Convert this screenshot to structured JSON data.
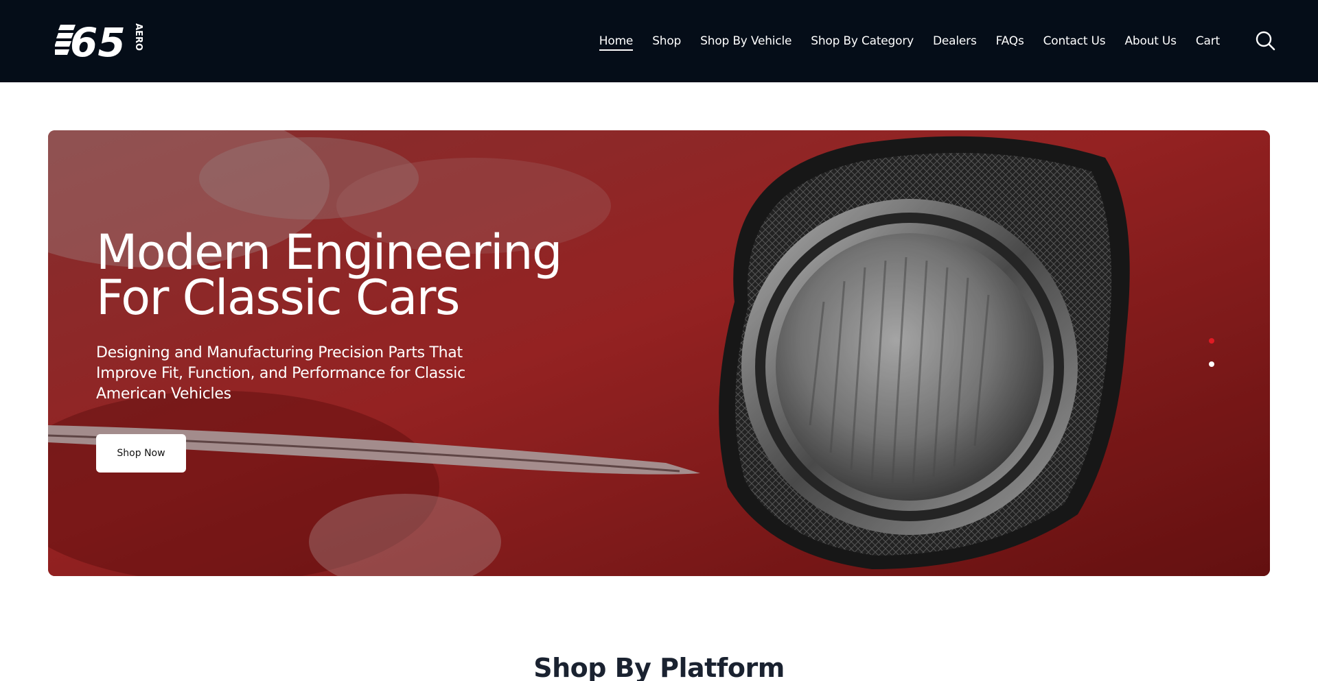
{
  "brand": {
    "logo_text": "65",
    "logo_side_text": "AERO"
  },
  "nav": {
    "items": [
      {
        "label": "Home",
        "active": true
      },
      {
        "label": "Shop",
        "active": false
      },
      {
        "label": "Shop By Vehicle",
        "active": false
      },
      {
        "label": "Shop By Category",
        "active": false
      },
      {
        "label": "Dealers",
        "active": false
      },
      {
        "label": "FAQs",
        "active": false
      },
      {
        "label": "Contact Us",
        "active": false
      },
      {
        "label": "About Us",
        "active": false
      },
      {
        "label": "Cart",
        "active": false
      }
    ],
    "search_icon": "search-icon"
  },
  "hero": {
    "title_line1": "Modern Engineering",
    "title_line2": "For Classic Cars",
    "subtitle": "Designing and Manufacturing Precision Parts That Improve Fit, Function, and Performance for Classic American Vehicles",
    "button_label": "Shop Now",
    "slides_count": 2,
    "active_slide": 1
  },
  "sections": {
    "platform_title": "Shop By Platform"
  },
  "colors": {
    "header_bg": "#050d18",
    "accent_red": "#e01b24",
    "hero_red": "#8f1f1f",
    "text_dark": "#1a2230"
  }
}
